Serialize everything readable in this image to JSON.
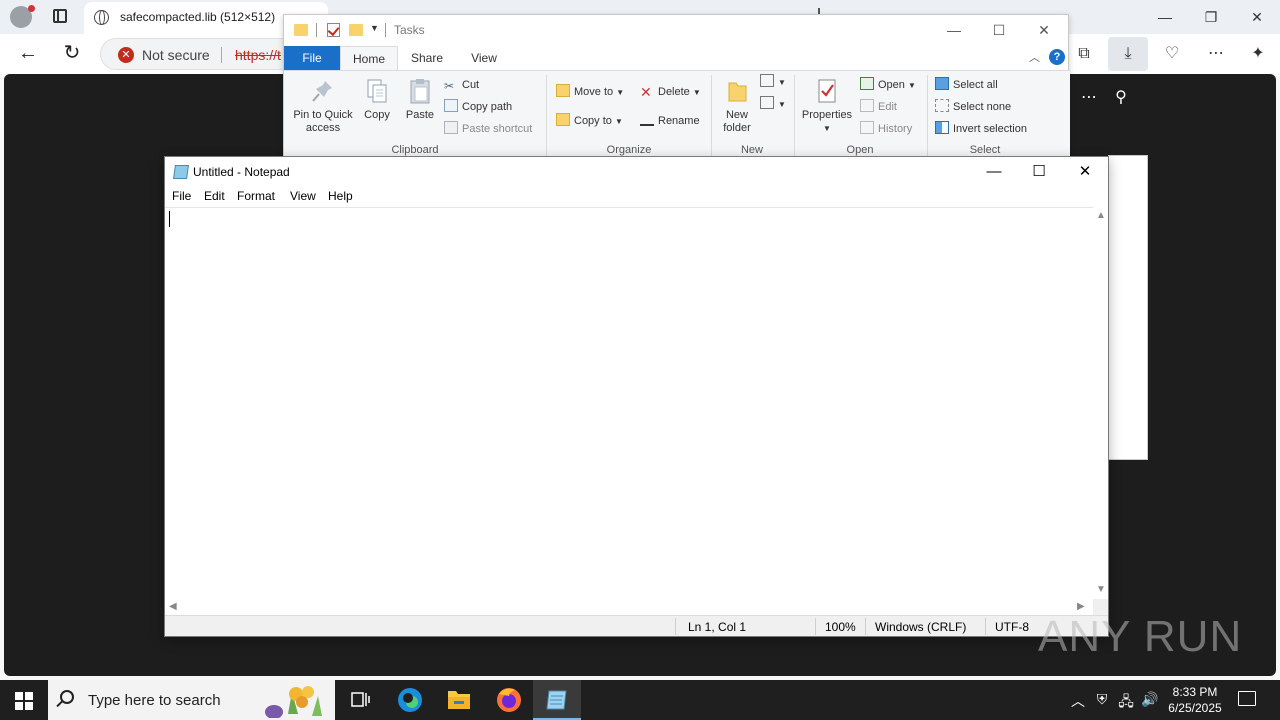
{
  "browser": {
    "active_tab_title": "safecompacted.lib (512×512)",
    "security_label": "Not secure",
    "url_visible": "https://t",
    "colors": {
      "tabbar_bg": "#eceff3",
      "error_red": "#c42b1c",
      "content_bg": "#1d1d1d"
    }
  },
  "explorer": {
    "title": "Tasks",
    "tabs": [
      "File",
      "Home",
      "Share",
      "View"
    ],
    "clipboard": {
      "label": "Clipboard",
      "pin_label": "Pin to Quick access",
      "copy_label": "Copy",
      "paste_label": "Paste",
      "cut_label": "Cut",
      "copy_path_label": "Copy path",
      "paste_shortcut_label": "Paste shortcut"
    },
    "organize": {
      "label": "Organize",
      "move_to_label": "Move to",
      "copy_to_label": "Copy to",
      "delete_label": "Delete",
      "rename_label": "Rename"
    },
    "new": {
      "label": "New",
      "new_folder_label": "New folder"
    },
    "open": {
      "label": "Open",
      "properties_label": "Properties",
      "open_label": "Open",
      "edit_label": "Edit",
      "history_label": "History"
    },
    "select": {
      "label": "Select",
      "select_all_label": "Select all",
      "select_none_label": "Select none",
      "invert_label": "Invert selection"
    },
    "colors": {
      "file_tab": "#1a6fc9",
      "ribbon_bg": "#f5f6f7"
    }
  },
  "notepad": {
    "title": "Untitled - Notepad",
    "menus": [
      "File",
      "Edit",
      "Format",
      "View",
      "Help"
    ],
    "content": "",
    "status": {
      "position": "Ln 1, Col 1",
      "zoom": "100%",
      "line_ending": "Windows (CRLF)",
      "encoding": "UTF-8"
    }
  },
  "watermark": {
    "text": "ANY RUN"
  },
  "taskbar": {
    "search_placeholder": "Type here to search",
    "apps": [
      "task-view",
      "edge",
      "file-explorer",
      "firefox",
      "notepad"
    ],
    "active_app": "notepad",
    "time": "8:33 PM",
    "date": "6/25/2025"
  }
}
